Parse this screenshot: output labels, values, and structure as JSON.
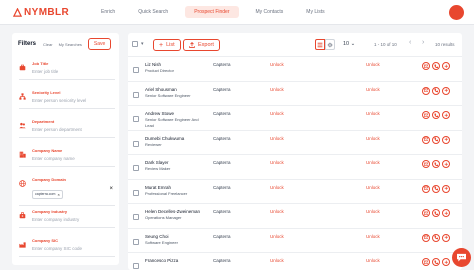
{
  "app": {
    "logo_text": "NYMBLR",
    "brand_color": "#e8472f",
    "avatar_initials": ""
  },
  "nav": {
    "items": [
      {
        "label": "Enrich"
      },
      {
        "label": "Quick Search"
      },
      {
        "label": "Prospect Finder"
      },
      {
        "label": "My Contacts"
      },
      {
        "label": "My Lists"
      }
    ],
    "active_index": 2
  },
  "filters": {
    "title": "Filters",
    "clear_label": "Clear",
    "my_searches_label": "My Searches",
    "save_label": "Save",
    "fields": [
      {
        "label": "Job Title",
        "placeholder": "Enter job title",
        "icon": "briefcase-icon"
      },
      {
        "label": "Seniority Level",
        "placeholder": "Enter person seniority level",
        "icon": "hierarchy-icon"
      },
      {
        "label": "Department",
        "placeholder": "Enter person department",
        "icon": "people-icon"
      },
      {
        "label": "Company Name",
        "placeholder": "Enter company name",
        "icon": "building-icon"
      },
      {
        "label": "Company Domain",
        "chip": "capterra.com",
        "icon": "globe-icon"
      },
      {
        "label": "Company Industry",
        "placeholder": "Enter company industry",
        "icon": "industry-icon"
      },
      {
        "label": "Company SIC",
        "placeholder": "Enter company SIC code",
        "icon": "factory-icon"
      }
    ]
  },
  "toolbar": {
    "list_label": "List",
    "export_label": "Export",
    "per_page": "10",
    "range": "1 - 10 of 10",
    "total_results": "10 results"
  },
  "table": {
    "unlock_label": "Unlock",
    "rows": [
      {
        "name": "Liz Nish",
        "title": "Product Director",
        "company": "Capterra"
      },
      {
        "name": "Ariel Shousman",
        "title": "Senior Software Engineer",
        "company": "Capterra"
      },
      {
        "name": "Andrew Stowe",
        "title": "Senior Software Engineer And Lead",
        "company": "Capterra"
      },
      {
        "name": "Dumebi Chukwuma",
        "title": "Reviewer",
        "company": "Capterra"
      },
      {
        "name": "Dark Slayer",
        "title": "Review Maker",
        "company": "Capterra"
      },
      {
        "name": "Murat Emrah",
        "title": "Professional Freelancer",
        "company": "Capterra"
      },
      {
        "name": "Helen Decelles-Zweineman",
        "title": "Operations Manager",
        "company": "Capterra"
      },
      {
        "name": "Seung Choi",
        "title": "Software Engineer",
        "company": "Capterra"
      },
      {
        "name": "Francesco Pizza",
        "title": "",
        "company": "Capterra"
      }
    ]
  }
}
